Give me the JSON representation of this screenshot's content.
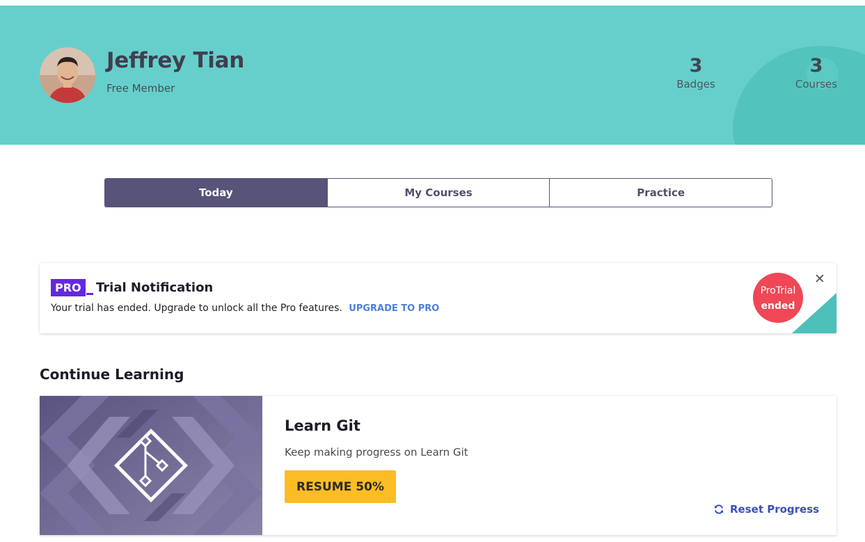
{
  "profile": {
    "name": "Jeffrey Tian",
    "tier": "Free Member",
    "avatar_icon": "user-photo"
  },
  "stats": {
    "badges": {
      "value": "3",
      "label": "Badges"
    },
    "courses": {
      "value": "3",
      "label": "Courses"
    }
  },
  "tabs": [
    {
      "label": "Today",
      "active": true
    },
    {
      "label": "My Courses",
      "active": false
    },
    {
      "label": "Practice",
      "active": false
    }
  ],
  "notification": {
    "pro_label": "PRO",
    "title": "Trial Notification",
    "message": "Your trial has ended. Upgrade to unlock all the Pro features.",
    "link_label": "UPGRADE TO PRO",
    "badge_line1": "ProTrial",
    "badge_line2": "ended",
    "close_icon": "close-icon"
  },
  "continue_learning": {
    "heading": "Continue Learning",
    "course": {
      "title": "Learn Git",
      "subtitle": "Keep making progress on Learn Git",
      "resume_label": "RESUME 50%",
      "progress_percent": 50,
      "reset_label": "Reset Progress",
      "art_icon": "git-branch-icon"
    }
  },
  "colors": {
    "hero": "#67cfcb",
    "tab_active": "#585378",
    "pro": "#6428e0",
    "trial_badge": "#ef4756",
    "resume": "#fbbc24",
    "link": "#4d7fd8"
  }
}
